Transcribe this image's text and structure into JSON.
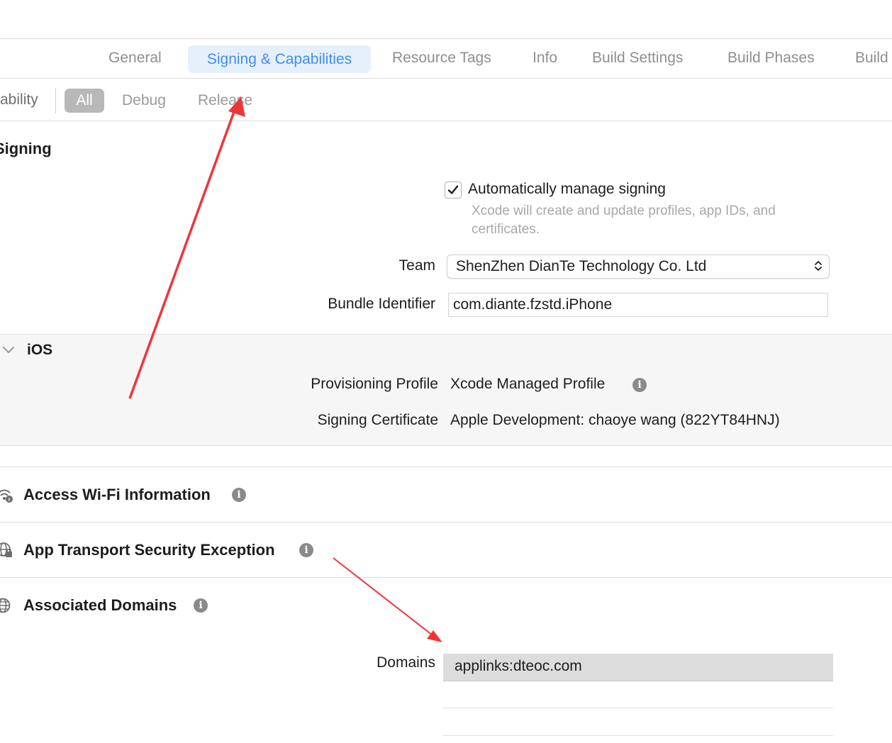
{
  "tabs": [
    {
      "label": "General"
    },
    {
      "label": "Signing & Capabilities"
    },
    {
      "label": "Resource Tags"
    },
    {
      "label": "Info"
    },
    {
      "label": "Build Settings"
    },
    {
      "label": "Build Phases"
    },
    {
      "label": "Build"
    }
  ],
  "active_tab_color": "#3d8ef0",
  "filter": {
    "capability_label": "ability",
    "items": [
      {
        "label": "All"
      },
      {
        "label": "Debug"
      },
      {
        "label": "Release"
      }
    ]
  },
  "signing": {
    "section_title": "Signing",
    "auto_manage_label": "Automatically manage signing",
    "auto_manage_checked": true,
    "auto_manage_help_line1": "Xcode will create and update profiles, app IDs, and",
    "auto_manage_help_line2": "certificates.",
    "team_label": "Team",
    "team_value": "ShenZhen DianTe Technology Co. Ltd",
    "bundle_label": "Bundle Identifier",
    "bundle_value": "com.diante.fzstd.iPhone"
  },
  "ios": {
    "title": "iOS",
    "profile_label": "Provisioning Profile",
    "profile_value": "Xcode Managed Profile",
    "certificate_label": "Signing Certificate",
    "certificate_value": "Apple Development: chaoye wang (822YT84HNJ)"
  },
  "capabilities": [
    {
      "title": "Access Wi-Fi Information",
      "icon": "wifi-info-icon"
    },
    {
      "title": "App Transport Security Exception",
      "icon": "globe-lock-icon"
    },
    {
      "title": "Associated Domains",
      "icon": "globe-icon"
    }
  ],
  "domains": {
    "label": "Domains",
    "entries": [
      "applinks:dteoc.com"
    ]
  },
  "annotation_color": "#f0353a"
}
